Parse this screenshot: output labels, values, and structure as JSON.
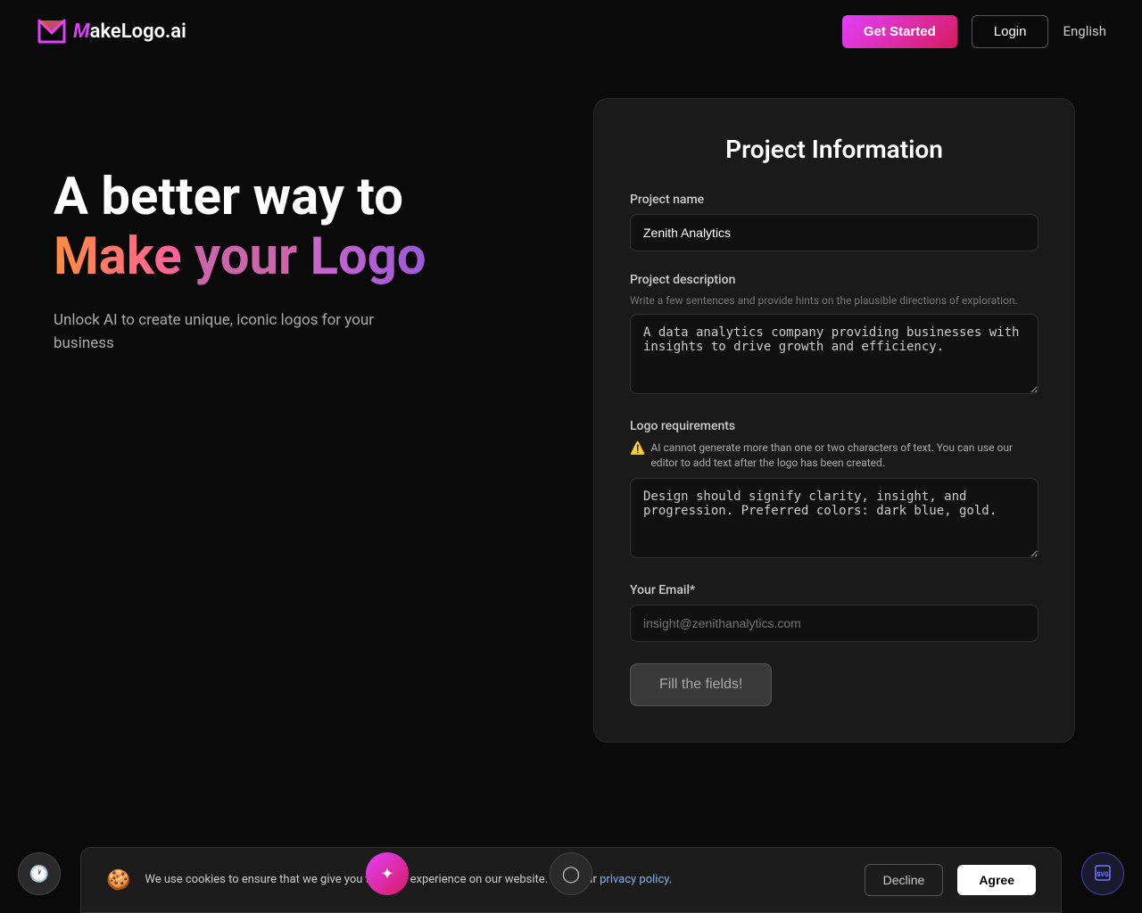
{
  "header": {
    "logo_text": "akeLogo.ai",
    "logo_m": "M",
    "get_started_label": "Get Started",
    "login_label": "Login",
    "language_label": "English"
  },
  "hero": {
    "line1": "A better way to",
    "line2_make": "Make",
    "line2_your": "your",
    "line2_logo": "Logo",
    "subtitle": "Unlock AI to create unique, iconic logos for your business"
  },
  "form": {
    "title": "Project Information",
    "project_name_label": "Project name",
    "project_name_value": "Zenith Analytics",
    "project_description_label": "Project description",
    "project_description_hint": "Write a few sentences and provide hints on the plausible directions of exploration.",
    "project_description_value": "A data analytics company providing businesses with insights to drive growth and efficiency.",
    "logo_requirements_label": "Logo requirements",
    "logo_warning": "AI cannot generate more than one or two characters of text. You can use our editor to add text after the logo has been created.",
    "logo_requirements_value": "Design should signify clarity, insight, and progression. Preferred colors: dark blue, gold.",
    "email_label": "Your Email*",
    "email_placeholder": "insight@zenithanalytics.com",
    "submit_label": "Fill the fields!"
  },
  "cookie": {
    "text": "We use cookies to ensure that we give you the best experience on our website. Read our",
    "link_text": "privacy policy",
    "decline_label": "Decline",
    "agree_label": "Agree"
  },
  "floats": {
    "svg_label": "SVG"
  }
}
